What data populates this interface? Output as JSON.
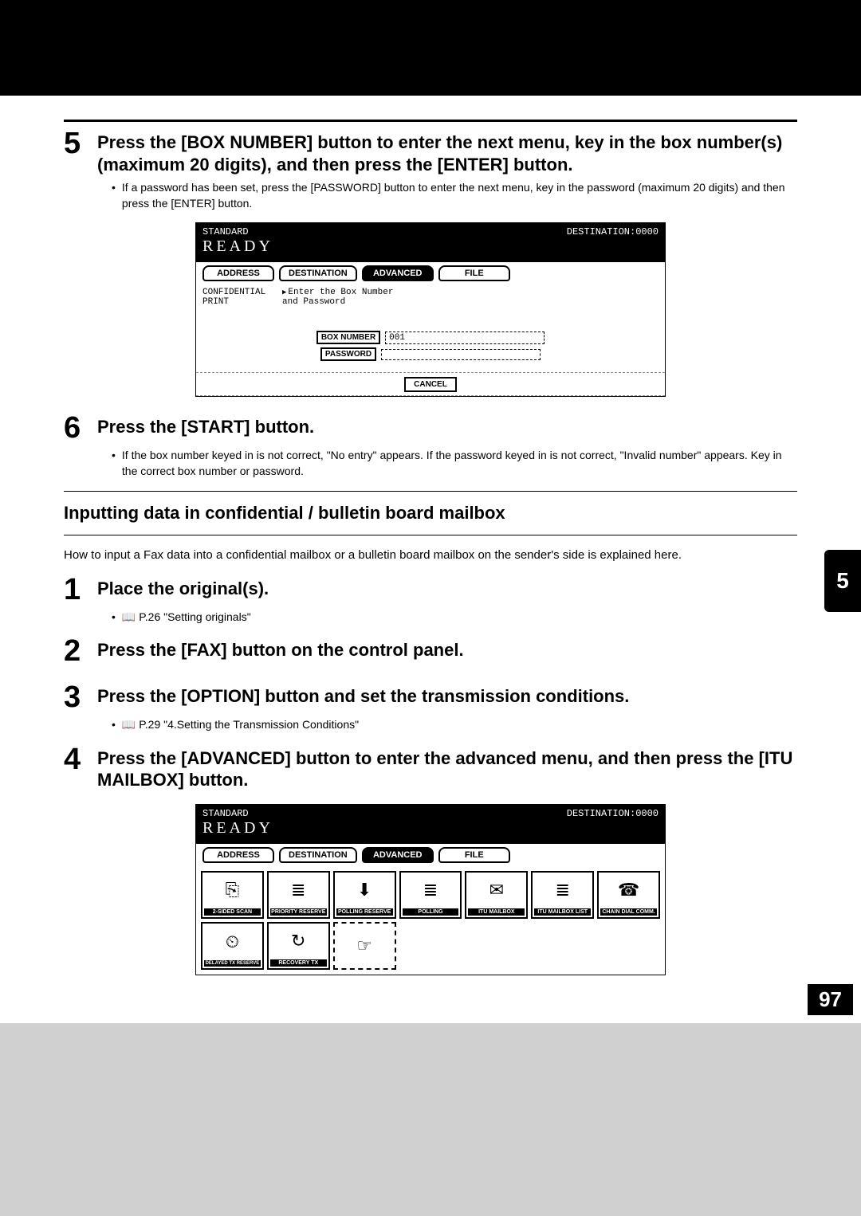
{
  "side_tab": "5",
  "page_number": "97",
  "step5": {
    "num": "5",
    "title": "Press the [BOX NUMBER] button to enter the next menu, key in the box number(s) (maximum 20 digits), and then press the [ENTER] button.",
    "bullet": "If a password has been set, press the [PASSWORD] button to enter the next menu, key in the password (maximum 20 digits) and then press the [ENTER] button."
  },
  "screen1": {
    "status_left": "STANDARD",
    "status_right": "DESTINATION:0000",
    "ready": "READY",
    "tabs": [
      "ADDRESS",
      "DESTINATION",
      "ADVANCED",
      "FILE"
    ],
    "active_tab_index": 2,
    "left_label": "CONFIDENTIAL\nPRINT",
    "prompt": "Enter the Box Number\nand Password",
    "box_number_label": "BOX NUMBER",
    "box_number_value": "001",
    "password_label": "PASSWORD",
    "password_value": "",
    "cancel": "CANCEL"
  },
  "step6": {
    "num": "6",
    "title": "Press the [START] button.",
    "bullet": "If the box number keyed in is not correct, \"No entry\" appears. If the password keyed in is not correct, \"Invalid number\" appears. Key in the correct box number or password."
  },
  "section": {
    "heading": "Inputting data in confidential / bulletin board mailbox",
    "desc": "How to input a Fax data into a confidential mailbox or a bulletin board mailbox on the sender's side is explained here."
  },
  "b_step1": {
    "num": "1",
    "title": "Place the original(s).",
    "bullet_ref": "P.26 \"Setting originals\""
  },
  "b_step2": {
    "num": "2",
    "title": "Press the [FAX] button on the control panel."
  },
  "b_step3": {
    "num": "3",
    "title": "Press the [OPTION] button and set the transmission conditions.",
    "bullet_ref": "P.29 \"4.Setting the Transmission Conditions\""
  },
  "b_step4": {
    "num": "4",
    "title": "Press the [ADVANCED] button to enter the advanced menu, and then press the [ITU MAILBOX] button."
  },
  "screen2": {
    "status_left": "STANDARD",
    "status_right": "DESTINATION:0000",
    "ready": "READY",
    "tabs": [
      "ADDRESS",
      "DESTINATION",
      "ADVANCED",
      "FILE"
    ],
    "active_tab_index": 2,
    "row1": [
      {
        "icon": "⎘",
        "label": "2-SIDED SCAN"
      },
      {
        "icon": "≣",
        "label": "PRIORITY RESERVE"
      },
      {
        "icon": "⬇",
        "label": "POLLING RESERVE"
      },
      {
        "icon": "≣",
        "label": "POLLING"
      },
      {
        "icon": "✉",
        "label": "ITU MAILBOX"
      },
      {
        "icon": "≣",
        "label": "ITU MAILBOX LIST"
      },
      {
        "icon": "☎",
        "label": "CHAIN DIAL COMM."
      }
    ],
    "row2": [
      {
        "icon": "⏲",
        "label": "DELAYED TX RESERVE"
      },
      {
        "icon": "↻",
        "label": "RECOVERY TX"
      },
      {
        "icon": "☞",
        "label": "",
        "dotted": true
      }
    ]
  }
}
